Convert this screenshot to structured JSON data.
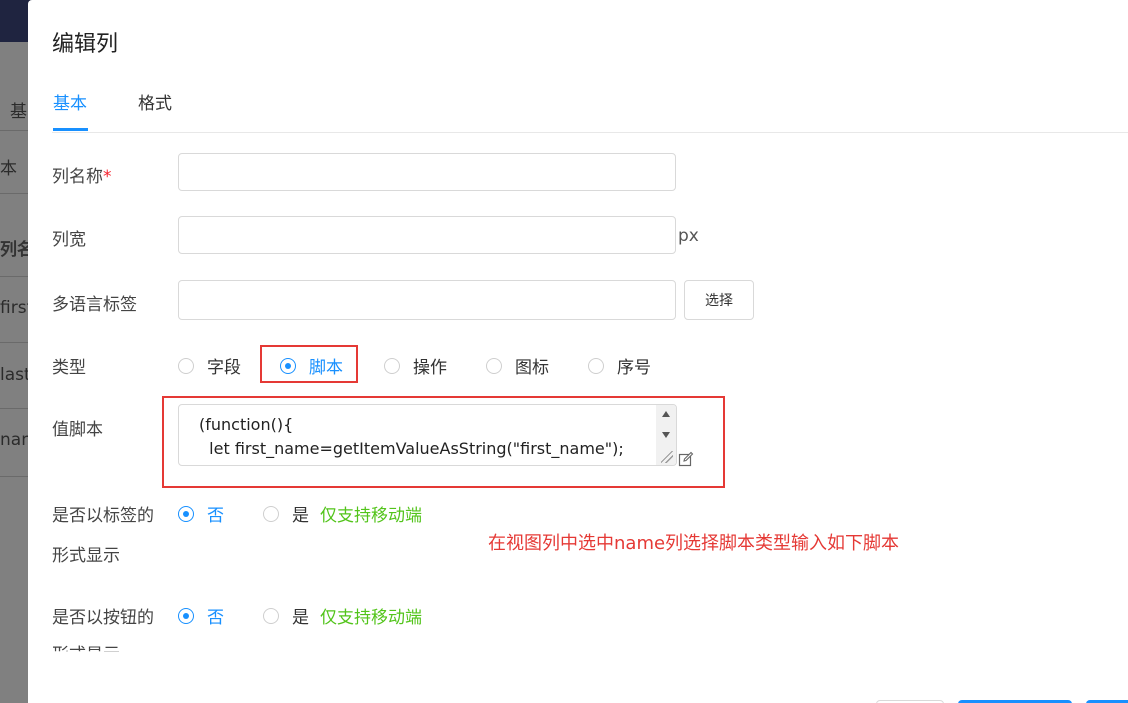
{
  "background": {
    "items": [
      "基",
      "本",
      "列名",
      "first",
      "last_",
      "nam"
    ]
  },
  "dialog": {
    "title": "编辑列",
    "tabs": [
      {
        "label": "基本",
        "active": true
      },
      {
        "label": "格式",
        "active": false
      }
    ]
  },
  "form": {
    "column_name": {
      "label": "列名称",
      "required_mark": "*",
      "value": ""
    },
    "column_width": {
      "label": "列宽",
      "value": "",
      "unit": "px"
    },
    "i18n_label": {
      "label": "多语言标签",
      "value": "",
      "select_button": "选择"
    },
    "type": {
      "label": "类型",
      "options": [
        "字段",
        "脚本",
        "操作",
        "图标",
        "序号"
      ],
      "selected": "脚本"
    },
    "value_script": {
      "label": "值脚本",
      "lines": [
        "(function(){",
        "  let first_name=getItemValueAsString(\"first_name\");"
      ],
      "icon": "edit-icon"
    },
    "show_as_tag": {
      "label_line1": "是否以标签的",
      "label_line2": "形式显示",
      "options": [
        "否",
        "是"
      ],
      "selected": "否",
      "note": "仅支持移动端"
    },
    "show_as_button": {
      "label_line1": "是否以按钮的",
      "label_line2": "形式显示",
      "options": [
        "否",
        "是"
      ],
      "selected": "否",
      "note": "仅支持移动端"
    }
  },
  "annotation": "在视图列中选中name列选择脚本类型输入如下脚本",
  "colors": {
    "primary": "#1890ff",
    "highlight": "#e53935",
    "note": "#52c41a"
  }
}
